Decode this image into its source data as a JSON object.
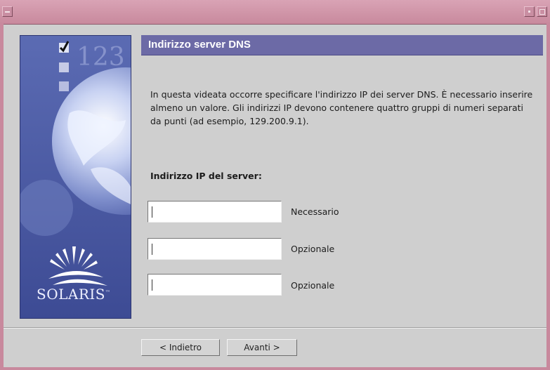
{
  "window": {
    "title": ""
  },
  "side_panel": {
    "logo_text": "SOLARIS",
    "step_numbers": "123"
  },
  "header": {
    "title": "Indirizzo server DNS"
  },
  "intro": "In questa videata occorre specificare l'indirizzo IP dei server DNS. È necessario inserire almeno un valore. Gli indirizzi IP devono contenere quattro gruppi di numeri separati da punti (ad esempio, 129.200.9.1).",
  "fields": {
    "label": "Indirizzo IP del server:",
    "inputs": [
      {
        "value": "",
        "note": "Necessario"
      },
      {
        "value": "",
        "note": "Opzionale"
      },
      {
        "value": "",
        "note": "Opzionale"
      }
    ]
  },
  "buttons": {
    "back": "< Indietro",
    "next": "Avanti >"
  },
  "colors": {
    "titlebar": "#c8899d",
    "header_bar": "#6c6aa6",
    "side_panel": "#4a5aa0"
  }
}
